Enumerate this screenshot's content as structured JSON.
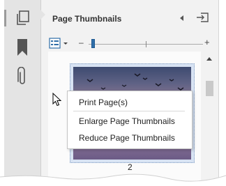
{
  "panel": {
    "title": "Page Thumbnails"
  },
  "thumbnail": {
    "page_number": "2"
  },
  "context_menu": {
    "items": [
      "Print Page(s)",
      "Enlarge Page Thumbnails",
      "Reduce Page Thumbnails"
    ]
  },
  "zoom": {
    "minus_label": "–",
    "plus_label": "+",
    "level": 0.03
  },
  "icons": {
    "rail": [
      "page-thumbnails-icon",
      "bookmarks-icon",
      "attachments-icon"
    ],
    "header": [
      "collapse-arrow-icon",
      "close-panel-icon"
    ]
  },
  "colors": {
    "accent": "#2f6ea8",
    "panel_bg": "#f2f2f2",
    "rail_bg": "#e4e4e4"
  }
}
